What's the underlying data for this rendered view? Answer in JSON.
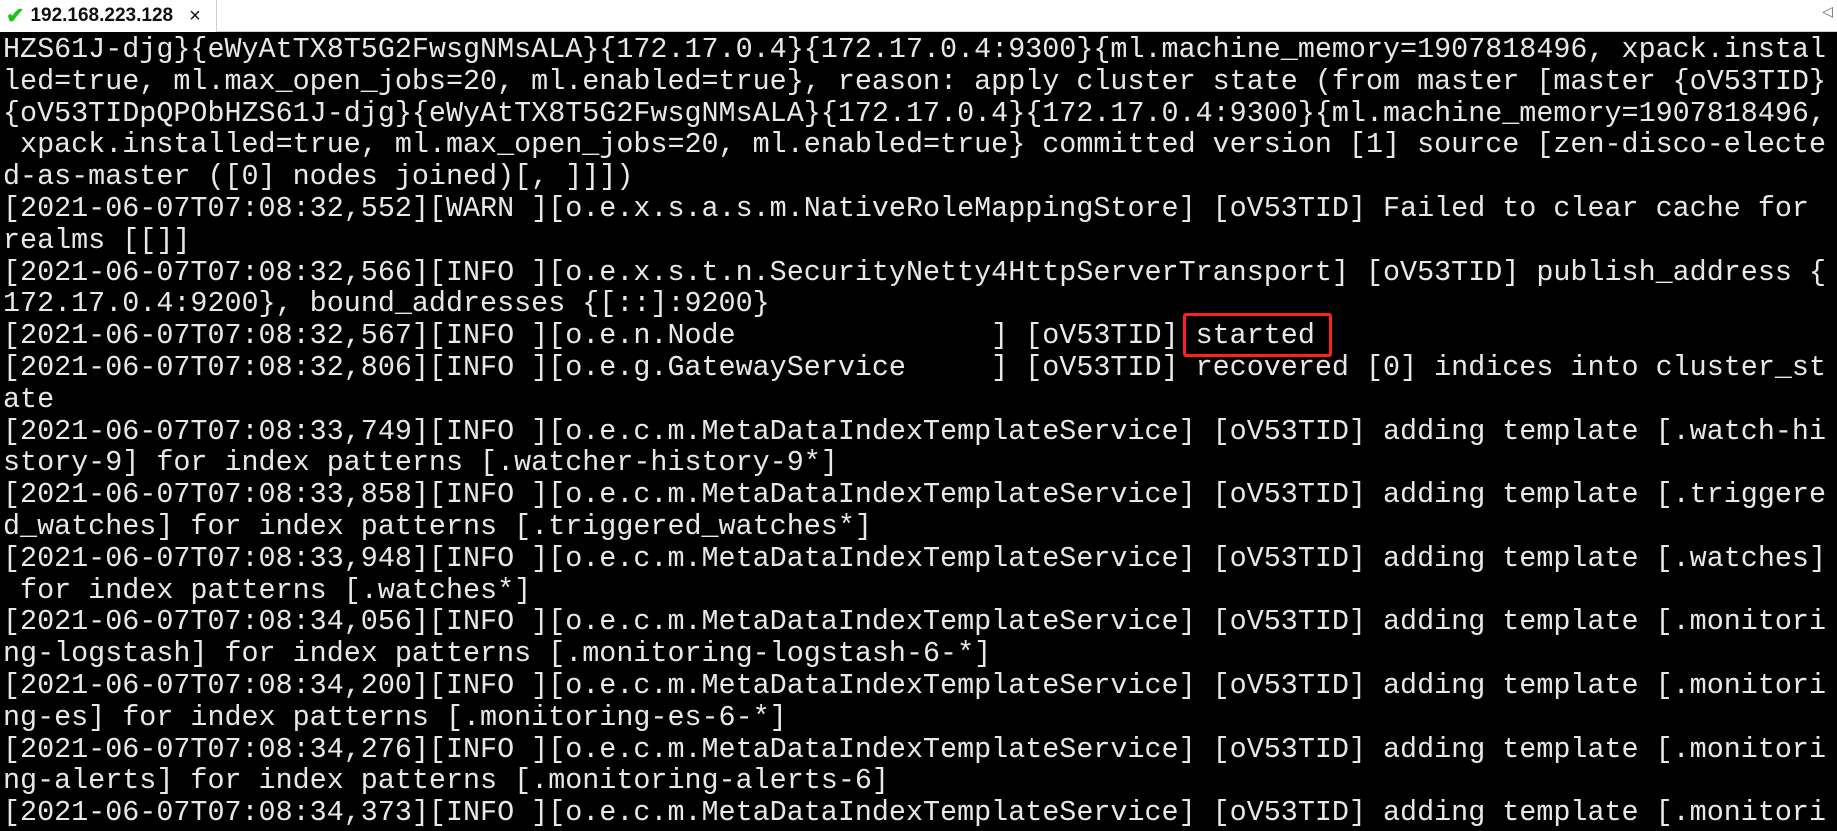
{
  "tab": {
    "title": "192.168.223.128",
    "status_icon": "check-icon",
    "close_label": "×",
    "scroll_arrow": "◁"
  },
  "colors": {
    "background": "#000000",
    "text": "#e8e8e8",
    "highlight_box": "#ff2020",
    "status_ok": "#1fc21f"
  },
  "terminal": {
    "lines": [
      {
        "text": "HZS61J-djg}{eWyAtTX8T5G2FwsgNMsALA}{172.17.0.4}{172.17.0.4:9300}{ml.machine_memory=1907818496, xpack.instal"
      },
      {
        "text": "led=true, ml.max_open_jobs=20, ml.enabled=true}, reason: apply cluster state (from master [master {oV53TID}"
      },
      {
        "text": "{oV53TIDpQPObHZS61J-djg}{eWyAtTX8T5G2FwsgNMsALA}{172.17.0.4}{172.17.0.4:9300}{ml.machine_memory=1907818496,"
      },
      {
        "text": " xpack.installed=true, ml.max_open_jobs=20, ml.enabled=true} committed version [1] source [zen-disco-electe"
      },
      {
        "text": "d-as-master ([0] nodes joined)[, ]]])"
      },
      {
        "text": "[2021-06-07T07:08:32,552][WARN ][o.e.x.s.a.s.m.NativeRoleMappingStore] [oV53TID] Failed to clear cache for"
      },
      {
        "text": "realms [[]]"
      },
      {
        "text": "[2021-06-07T07:08:32,566][INFO ][o.e.x.s.t.n.SecurityNetty4HttpServerTransport] [oV53TID] publish_address {"
      },
      {
        "text": "172.17.0.4:9200}, bound_addresses {[::]:9200}"
      },
      {
        "text": "[2021-06-07T07:08:32,567][INFO ][o.e.n.Node               ] [oV53TID] ",
        "highlight": "started"
      },
      {
        "text": "[2021-06-07T07:08:32,806][INFO ][o.e.g.GatewayService     ] [oV53TID] recovered [0] indices into cluster_st"
      },
      {
        "text": "ate"
      },
      {
        "text": "[2021-06-07T07:08:33,749][INFO ][o.e.c.m.MetaDataIndexTemplateService] [oV53TID] adding template [.watch-hi"
      },
      {
        "text": "story-9] for index patterns [.watcher-history-9*]"
      },
      {
        "text": "[2021-06-07T07:08:33,858][INFO ][o.e.c.m.MetaDataIndexTemplateService] [oV53TID] adding template [.triggere"
      },
      {
        "text": "d_watches] for index patterns [.triggered_watches*]"
      },
      {
        "text": "[2021-06-07T07:08:33,948][INFO ][o.e.c.m.MetaDataIndexTemplateService] [oV53TID] adding template [.watches]"
      },
      {
        "text": " for index patterns [.watches*]"
      },
      {
        "text": "[2021-06-07T07:08:34,056][INFO ][o.e.c.m.MetaDataIndexTemplateService] [oV53TID] adding template [.monitori"
      },
      {
        "text": "ng-logstash] for index patterns [.monitoring-logstash-6-*]"
      },
      {
        "text": "[2021-06-07T07:08:34,200][INFO ][o.e.c.m.MetaDataIndexTemplateService] [oV53TID] adding template [.monitori"
      },
      {
        "text": "ng-es] for index patterns [.monitoring-es-6-*]"
      },
      {
        "text": "[2021-06-07T07:08:34,276][INFO ][o.e.c.m.MetaDataIndexTemplateService] [oV53TID] adding template [.monitori"
      },
      {
        "text": "ng-alerts] for index patterns [.monitoring-alerts-6]"
      },
      {
        "text": "[2021-06-07T07:08:34,373][INFO ][o.e.c.m.MetaDataIndexTemplateService] [oV53TID] adding template [.monitori"
      }
    ]
  }
}
